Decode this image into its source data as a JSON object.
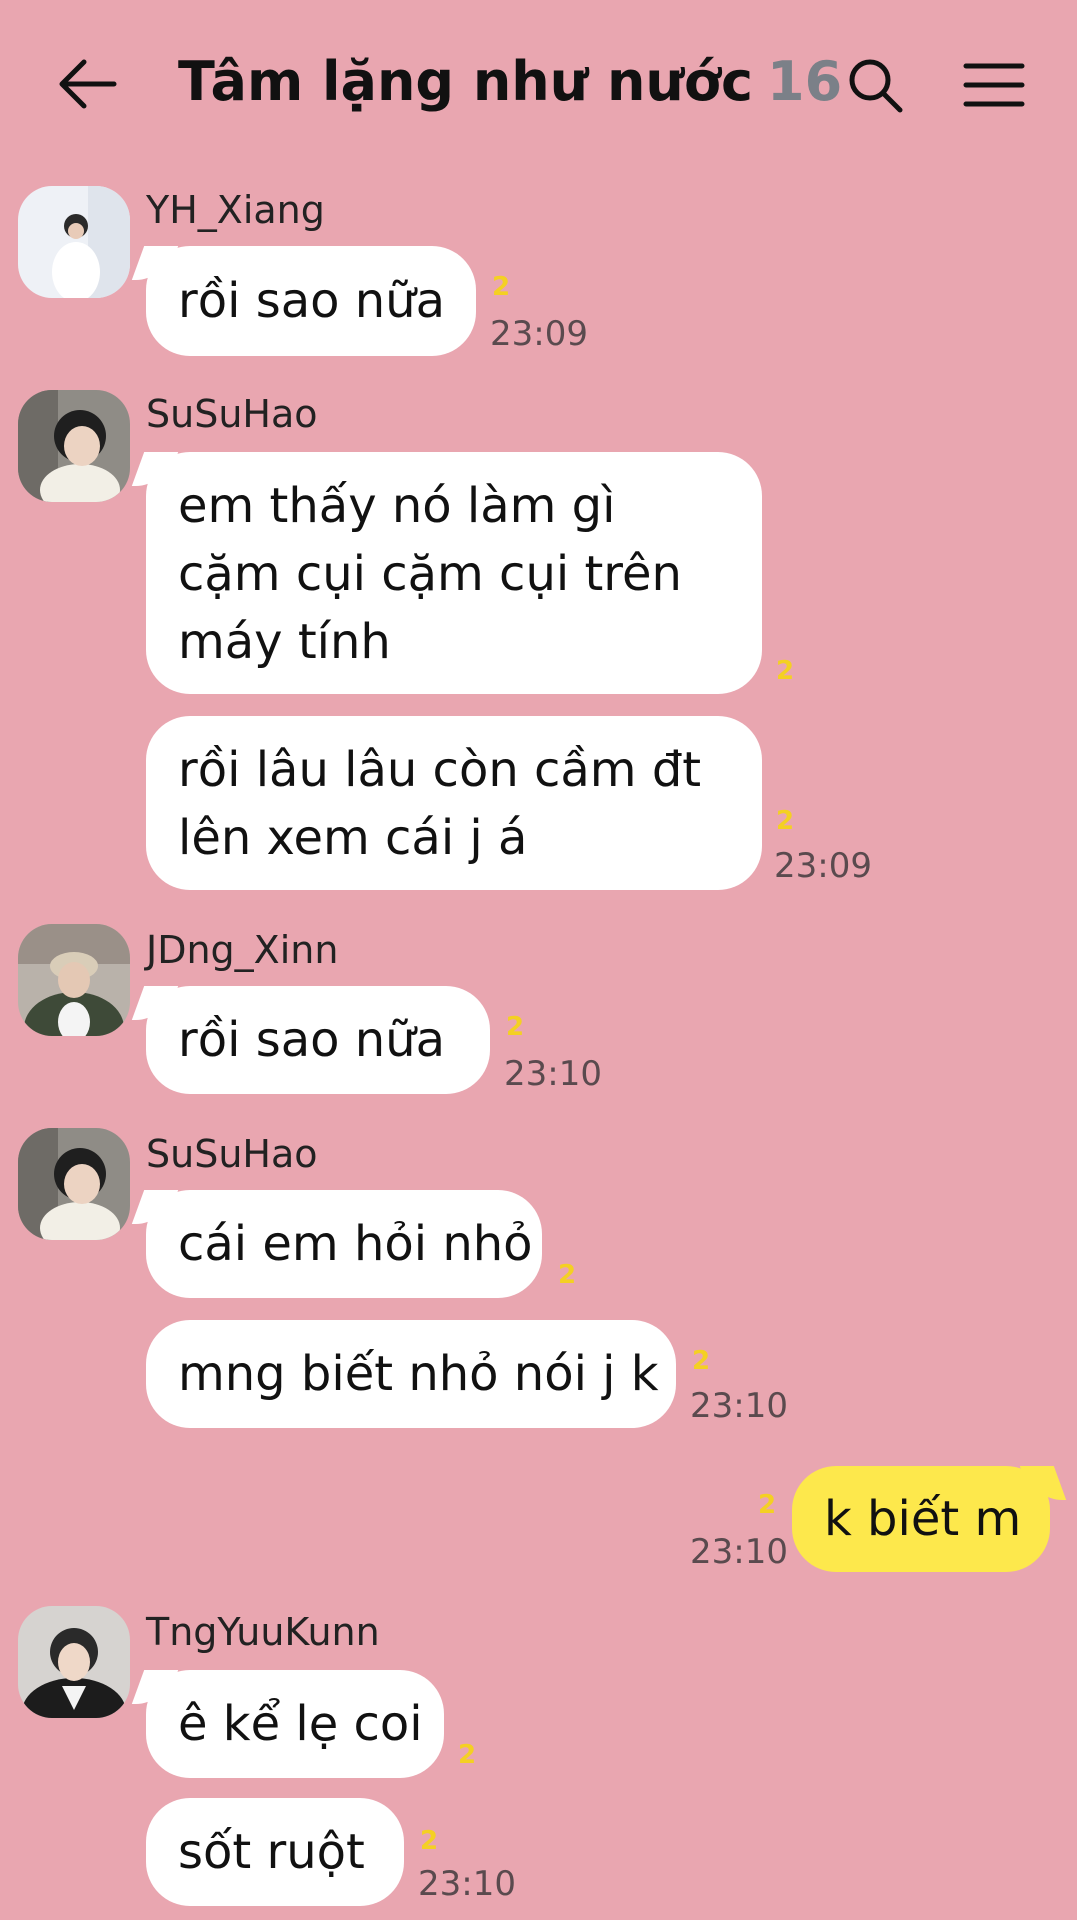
{
  "header": {
    "title": "Tâm lặng như nước",
    "member_count": "16"
  },
  "messages": [
    {
      "sender": "YH_Xiang",
      "text": "rồi sao nữa",
      "unread": "2",
      "time": "23:09"
    },
    {
      "sender": "SuSuHao",
      "text": "em thấy nó làm gì cặm cụi cặm cụi trên máy tính",
      "unread": "2"
    },
    {
      "text": "rồi lâu lâu còn cầm đt lên xem cái j á",
      "unread": "2",
      "time": "23:09"
    },
    {
      "sender": "JDng_Xinn",
      "text": "rồi sao nữa",
      "unread": "2",
      "time": "23:10"
    },
    {
      "sender": "SuSuHao",
      "text": "cái em hỏi nhỏ",
      "unread": "2"
    },
    {
      "text": "mng biết nhỏ nói j k",
      "unread": "2",
      "time": "23:10"
    },
    {
      "text": "k biết m",
      "unread": "2",
      "time": "23:10",
      "own": true
    },
    {
      "sender": "TngYuuKunn",
      "text": "ê kể lẹ coi",
      "unread": "2"
    },
    {
      "text": "sốt ruột",
      "unread": "2",
      "time": "23:10"
    }
  ],
  "colors": {
    "background": "#e9a6b0",
    "bubble_in": "#ffffff",
    "bubble_out": "#fde84c",
    "unread": "#f4d023"
  },
  "icons": [
    "back-arrow-icon",
    "search-icon",
    "menu-icon"
  ]
}
